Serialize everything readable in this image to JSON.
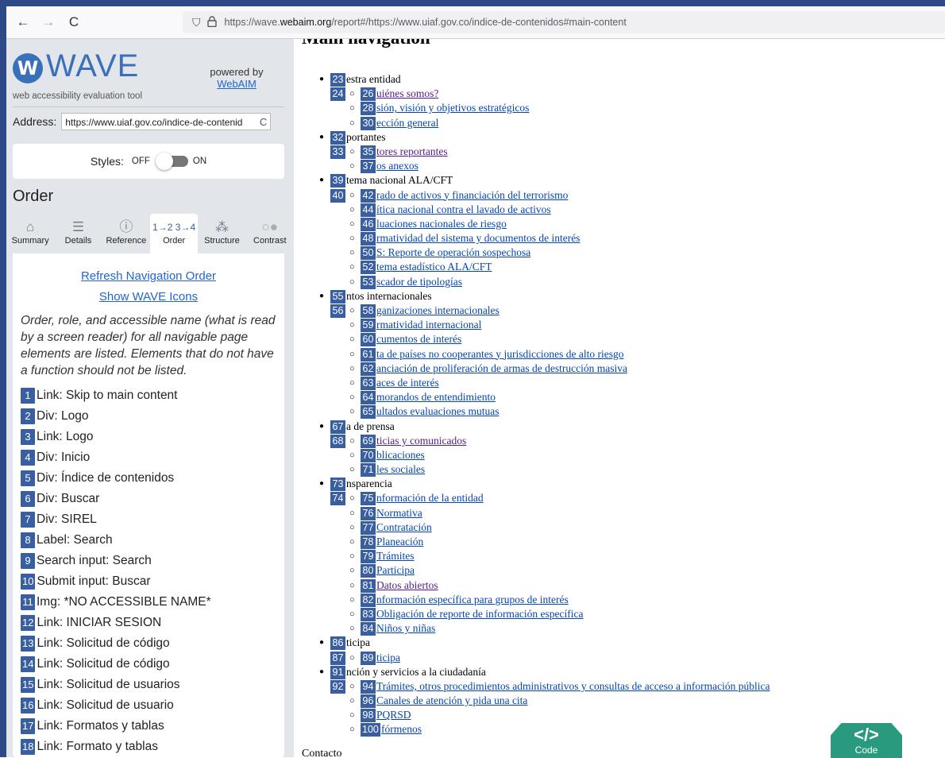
{
  "browser": {
    "back_icon": "←",
    "forward_icon": "→",
    "reload_icon": "C",
    "url_prefix": "https://wave.",
    "url_domain": "webaim.org",
    "url_rest": "/report#/https://www.uiaf.gov.co/indice-de-contenidos#main-content"
  },
  "wave": {
    "logo_letter": "W",
    "logo_text": "WAVE",
    "logo_subtitle": "web accessibility evaluation tool",
    "powered_by": "powered by",
    "webaim_link": "WebAIM",
    "address_label": "Address:",
    "address_value": "https://www.uiaf.gov.co/indice-de-contenid",
    "styles_label": "Styles:",
    "styles_off": "OFF",
    "styles_on": "ON",
    "panel_title": "Order",
    "tabs": [
      {
        "label": "Summary",
        "icon": "⌂"
      },
      {
        "label": "Details",
        "icon": "☰"
      },
      {
        "label": "Reference",
        "icon": "ⓘ"
      },
      {
        "label": "Order",
        "icon": "1→2 3→4"
      },
      {
        "label": "Structure",
        "icon": "⁂"
      },
      {
        "label": "Contrast",
        "icon": "○●"
      }
    ],
    "refresh_link": "Refresh Navigation Order",
    "show_icons_link": "Show WAVE Icons",
    "explanation": "Order, role, and accessible name (what is read by a screen reader) for all navigable page elements are listed. Elements that do not have a function should not be listed.",
    "order_items": [
      {
        "n": "1",
        "text": "Link: Skip to main content"
      },
      {
        "n": "2",
        "text": "Div: Logo"
      },
      {
        "n": "3",
        "text": "Link: Logo"
      },
      {
        "n": "4",
        "text": "Div: Inicio"
      },
      {
        "n": "5",
        "text": "Div: Índice de contenidos"
      },
      {
        "n": "6",
        "text": "Div: Buscar"
      },
      {
        "n": "7",
        "text": "Div: SIREL"
      },
      {
        "n": "8",
        "text": "Label: Search"
      },
      {
        "n": "9",
        "text": "Search input: Search"
      },
      {
        "n": "10",
        "text": "Submit input: Buscar"
      },
      {
        "n": "11",
        "text": "Img: *NO ACCESSIBLE NAME*"
      },
      {
        "n": "12",
        "text": "Link: INICIAR SESION"
      },
      {
        "n": "13",
        "text": "Link: Solicitud de código"
      },
      {
        "n": "14",
        "text": "Link: Solicitud de código"
      },
      {
        "n": "15",
        "text": "Link: Solicitud de usuarios"
      },
      {
        "n": "16",
        "text": "Link: Solicitud de usuario"
      },
      {
        "n": "17",
        "text": "Link: Formatos y tablas"
      },
      {
        "n": "18",
        "text": "Link: Formato y tablas"
      }
    ]
  },
  "page": {
    "heading": "Main navigation",
    "bottom_text": "Contacto",
    "code_button_glyph": "</>",
    "code_button_label": "Code"
  },
  "tree": [
    {
      "level": 1,
      "n": "23",
      "text": "estra entidad"
    },
    {
      "level": 2,
      "pre": "24",
      "n": "26",
      "text": "uiénes somos?",
      "visited": true
    },
    {
      "level": 2,
      "n": "28",
      "text": "sión, visión y objetivos estratégicos"
    },
    {
      "level": 2,
      "n": "30",
      "text": "ección general"
    },
    {
      "level": 1,
      "n": "32",
      "text": "portantes"
    },
    {
      "level": 2,
      "pre": "33",
      "n": "35",
      "text": "tores reportantes",
      "visited": true
    },
    {
      "level": 2,
      "n": "37",
      "text": "os anexos"
    },
    {
      "level": 1,
      "n": "39",
      "text": "tema nacional ALA/CFT"
    },
    {
      "level": 2,
      "pre": "40",
      "n": "42",
      "text": "rado de activos y financiación del terrorismo"
    },
    {
      "level": 2,
      "n": "44",
      "text": "ítica nacional contra el lavado de activos"
    },
    {
      "level": 2,
      "n": "46",
      "text": "luaciones nacionales de riesgo"
    },
    {
      "level": 2,
      "n": "48",
      "text": "rmatividad del sistema y documentos de interés"
    },
    {
      "level": 2,
      "n": "50",
      "text": "S: Reporte de operación sospechosa"
    },
    {
      "level": 2,
      "n": "52",
      "text": "tema estadístico ALA/CFT"
    },
    {
      "level": 2,
      "n": "53",
      "text": "scador de tipologías"
    },
    {
      "level": 1,
      "n": "55",
      "text": "ntos internacionales"
    },
    {
      "level": 2,
      "pre": "56",
      "n": "58",
      "text": "ganizaciones internacionales"
    },
    {
      "level": 2,
      "n": "59",
      "text": "rmatividad internacional"
    },
    {
      "level": 2,
      "n": "60",
      "text": "cumentos de interés"
    },
    {
      "level": 2,
      "n": "61",
      "text": "ta de países no cooperantes y jurisdicciones de alto riesgo"
    },
    {
      "level": 2,
      "n": "62",
      "text": "anciación de proliferación de armas de destrucción masiva"
    },
    {
      "level": 2,
      "n": "63",
      "text": "aces de interés"
    },
    {
      "level": 2,
      "n": "64",
      "text": "morandos de entendimiento"
    },
    {
      "level": 2,
      "n": "65",
      "text": "ultados evaluaciones mutuas"
    },
    {
      "level": 1,
      "n": "67",
      "text": "a de prensa"
    },
    {
      "level": 2,
      "pre": "68",
      "n": "69",
      "text": "ticias y comunicados",
      "visited": true
    },
    {
      "level": 2,
      "n": "70",
      "text": "blicaciones"
    },
    {
      "level": 2,
      "n": "71",
      "text": "les sociales"
    },
    {
      "level": 1,
      "n": "73",
      "text": "nsparencia"
    },
    {
      "level": 2,
      "pre": "74",
      "n": "75",
      "text": "nformación de la entidad"
    },
    {
      "level": 2,
      "n": "76",
      "text": "Normativa"
    },
    {
      "level": 2,
      "n": "77",
      "text": "Contratación"
    },
    {
      "level": 2,
      "n": "78",
      "text": "Planeación"
    },
    {
      "level": 2,
      "n": "79",
      "text": "Trámites"
    },
    {
      "level": 2,
      "n": "80",
      "text": "Participa"
    },
    {
      "level": 2,
      "n": "81",
      "text": "Datos abiertos",
      "visited": true
    },
    {
      "level": 2,
      "n": "82",
      "text": "nformación específica para grupos de interés"
    },
    {
      "level": 2,
      "n": "83",
      "text": "Obligación de reporte de información específica"
    },
    {
      "level": 2,
      "n": "84",
      "text": " Niños y niñas"
    },
    {
      "level": 1,
      "n": "86",
      "text": "ticipa"
    },
    {
      "level": 2,
      "pre": "87",
      "n": "89",
      "text": "ticipa"
    },
    {
      "level": 1,
      "n": "91",
      "text": "nción y servicios a la ciudadanía"
    },
    {
      "level": 2,
      "pre": "92",
      "n": "94",
      "text": "Trámites, otros procedimientos administrativos y consultas de acceso a información pública"
    },
    {
      "level": 2,
      "n": "96",
      "text": "Canales de atención y pida una cita"
    },
    {
      "level": 2,
      "n": "98",
      "text": "PQRSD"
    },
    {
      "level": 2,
      "n": "100",
      "text": "fórmenos",
      "wide": true
    }
  ]
}
